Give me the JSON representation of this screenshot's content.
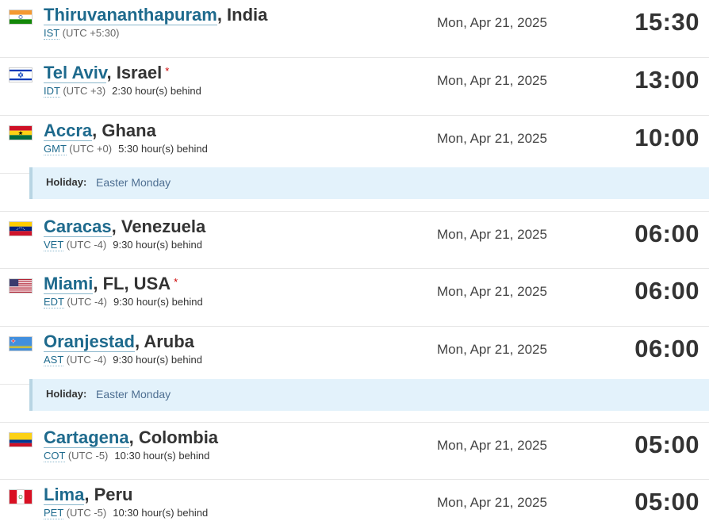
{
  "rows": [
    {
      "city": "Thiruvananthapuram",
      "country": ", India",
      "dst": "",
      "tz_abbr": "IST",
      "tz_offset": "(UTC +5:30)",
      "behind": "",
      "date": "Mon, Apr 21, 2025",
      "time": "15:30",
      "flag": "india-flag-icon"
    },
    {
      "city": "Tel Aviv",
      "country": ", Israel",
      "dst": "*",
      "tz_abbr": "IDT",
      "tz_offset": "(UTC +3)",
      "behind": "2:30 hour(s) behind",
      "date": "Mon, Apr 21, 2025",
      "time": "13:00",
      "flag": "israel-flag-icon"
    },
    {
      "city": "Accra",
      "country": ", Ghana",
      "dst": "",
      "tz_abbr": "GMT",
      "tz_offset": "(UTC +0)",
      "behind": "5:30 hour(s) behind",
      "date": "Mon, Apr 21, 2025",
      "time": "10:00",
      "flag": "ghana-flag-icon"
    },
    {
      "city": "Caracas",
      "country": ", Venezuela",
      "dst": "",
      "tz_abbr": "VET",
      "tz_offset": "(UTC -4)",
      "behind": "9:30 hour(s) behind",
      "date": "Mon, Apr 21, 2025",
      "time": "06:00",
      "flag": "venezuela-flag-icon"
    },
    {
      "city": "Miami",
      "country": ", FL, USA",
      "dst": "*",
      "tz_abbr": "EDT",
      "tz_offset": "(UTC -4)",
      "behind": "9:30 hour(s) behind",
      "date": "Mon, Apr 21, 2025",
      "time": "06:00",
      "flag": "usa-flag-icon"
    },
    {
      "city": "Oranjestad",
      "country": ", Aruba",
      "dst": "",
      "tz_abbr": "AST",
      "tz_offset": "(UTC -4)",
      "behind": "9:30 hour(s) behind",
      "date": "Mon, Apr 21, 2025",
      "time": "06:00",
      "flag": "aruba-flag-icon"
    },
    {
      "city": "Cartagena",
      "country": ", Colombia",
      "dst": "",
      "tz_abbr": "COT",
      "tz_offset": "(UTC -5)",
      "behind": "10:30 hour(s) behind",
      "date": "Mon, Apr 21, 2025",
      "time": "05:00",
      "flag": "colombia-flag-icon"
    },
    {
      "city": "Lima",
      "country": ", Peru",
      "dst": "",
      "tz_abbr": "PET",
      "tz_offset": "(UTC -5)",
      "behind": "10:30 hour(s) behind",
      "date": "Mon, Apr 21, 2025",
      "time": "05:00",
      "flag": "peru-flag-icon"
    }
  ],
  "holidays": [
    {
      "label": "Holiday:",
      "name": "Easter Monday"
    },
    {
      "label": "Holiday:",
      "name": "Easter Monday"
    }
  ],
  "colors": {
    "link": "#1e6a8d",
    "holiday_bg": "#e3f2fb",
    "holiday_text": "#4e6f92",
    "dst_marker": "#cc0000"
  }
}
